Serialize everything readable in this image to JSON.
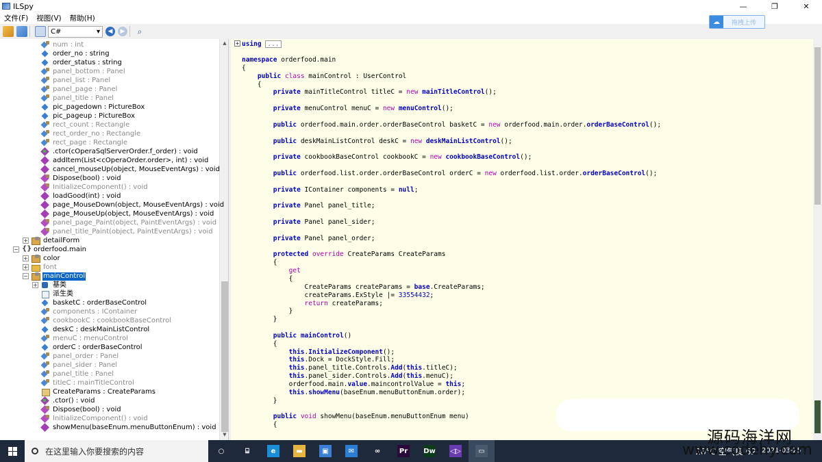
{
  "window": {
    "title": "ILSpy",
    "minimize": "—",
    "maximize": "❐",
    "close": "✕"
  },
  "menu": [
    "文件(F)",
    "视图(V)",
    "帮助(H)"
  ],
  "toolbar": {
    "language": "C#",
    "upload_label": "拖拽上传"
  },
  "tree": [
    {
      "text": "num : int",
      "indent": 60,
      "icon": "field",
      "gray": true
    },
    {
      "text": "order_no : string",
      "indent": 60,
      "icon": "fieldpub",
      "gray": false
    },
    {
      "text": "order_status : string",
      "indent": 60,
      "icon": "fieldpub",
      "gray": false
    },
    {
      "text": "panel_bottom : Panel",
      "indent": 60,
      "icon": "field",
      "gray": true
    },
    {
      "text": "panel_list : Panel",
      "indent": 60,
      "icon": "field",
      "gray": true
    },
    {
      "text": "panel_page : Panel",
      "indent": 60,
      "icon": "field",
      "gray": true
    },
    {
      "text": "panel_title : Panel",
      "indent": 60,
      "icon": "field",
      "gray": true
    },
    {
      "text": "pic_pagedown : PictureBox",
      "indent": 60,
      "icon": "fieldpub",
      "gray": false
    },
    {
      "text": "pic_pageup : PictureBox",
      "indent": 60,
      "icon": "fieldpub",
      "gray": false
    },
    {
      "text": "rect_count : Rectangle",
      "indent": 60,
      "icon": "field",
      "gray": true
    },
    {
      "text": "rect_order_no : Rectangle",
      "indent": 60,
      "icon": "field",
      "gray": true
    },
    {
      "text": "rect_page : Rectangle",
      "indent": 60,
      "icon": "field",
      "gray": true
    },
    {
      "text": ".ctor(cOperaSqlServerOrder.f_order) : void",
      "indent": 60,
      "icon": "ctor",
      "gray": false
    },
    {
      "text": "addItem(List<cOperaOrder.order>, int) : void",
      "indent": 60,
      "icon": "methodpub",
      "gray": false
    },
    {
      "text": "cancel_mouseUp(object, MouseEventArgs) : void",
      "indent": 60,
      "icon": "methodpub",
      "gray": false
    },
    {
      "text": "Dispose(bool) : void",
      "indent": 60,
      "icon": "method",
      "gray": false
    },
    {
      "text": "InitializeComponent() : void",
      "indent": 60,
      "icon": "method",
      "gray": true
    },
    {
      "text": "loadGood(int) : void",
      "indent": 60,
      "icon": "methodpub",
      "gray": false
    },
    {
      "text": "page_MouseDown(object, MouseEventArgs) : void",
      "indent": 60,
      "icon": "methodpub",
      "gray": false
    },
    {
      "text": "page_MouseUp(object, MouseEventArgs) : void",
      "indent": 60,
      "icon": "methodpub",
      "gray": false
    },
    {
      "text": "panel_page_Paint(object, PaintEventArgs) : void",
      "indent": 60,
      "icon": "method",
      "gray": true
    },
    {
      "text": "panel_title_Paint(object, PaintEventArgs) : void",
      "indent": 60,
      "icon": "method",
      "gray": true
    },
    {
      "text": "detailForm",
      "indent": 46,
      "icon": "cls",
      "gray": false,
      "expander": "+"
    },
    {
      "text": "orderfood.main",
      "indent": 32,
      "icon": "ns",
      "gray": false,
      "expander": "−"
    },
    {
      "text": "color",
      "indent": 46,
      "icon": "cls",
      "gray": false,
      "expander": "+"
    },
    {
      "text": "font",
      "indent": 46,
      "icon": "folder",
      "gray": true,
      "expander": "+"
    },
    {
      "text": "mainControl",
      "indent": 46,
      "icon": "cls",
      "gray": false,
      "expander": "−",
      "selected": true
    },
    {
      "text": "基类",
      "indent": 60,
      "icon": "base",
      "gray": false,
      "expander": "+"
    },
    {
      "text": "派生类",
      "indent": 60,
      "icon": "derived",
      "gray": false
    },
    {
      "text": "basketC : orderBaseControl",
      "indent": 60,
      "icon": "fieldpub",
      "gray": false
    },
    {
      "text": "components : IContainer",
      "indent": 60,
      "icon": "field",
      "gray": true
    },
    {
      "text": "cookbookC : cookbookBaseControl",
      "indent": 60,
      "icon": "field",
      "gray": true
    },
    {
      "text": "deskC : deskMainListControl",
      "indent": 60,
      "icon": "fieldpub",
      "gray": false
    },
    {
      "text": "menuC : menuControl",
      "indent": 60,
      "icon": "field",
      "gray": true
    },
    {
      "text": "orderC : orderBaseControl",
      "indent": 60,
      "icon": "fieldpub",
      "gray": false
    },
    {
      "text": "panel_order : Panel",
      "indent": 60,
      "icon": "field",
      "gray": true
    },
    {
      "text": "panel_sider : Panel",
      "indent": 60,
      "icon": "field",
      "gray": true
    },
    {
      "text": "panel_title : Panel",
      "indent": 60,
      "icon": "field",
      "gray": true
    },
    {
      "text": "titleC : mainTitleControl",
      "indent": 60,
      "icon": "field",
      "gray": true
    },
    {
      "text": "CreateParams : CreateParams",
      "indent": 60,
      "icon": "prop",
      "gray": false
    },
    {
      "text": ".ctor() : void",
      "indent": 60,
      "icon": "ctor",
      "gray": false
    },
    {
      "text": "Dispose(bool) : void",
      "indent": 60,
      "icon": "method",
      "gray": false
    },
    {
      "text": "InitializeComponent() : void",
      "indent": 60,
      "icon": "method",
      "gray": true
    },
    {
      "text": "showMenu(baseEnum.menuButtonEnum) : void",
      "indent": 60,
      "icon": "methodpub",
      "gray": false
    }
  ],
  "code": {
    "using_kw": "using",
    "using_fold": "...",
    "lines": [
      [
        {
          "t": "namespace ",
          "c": "kw"
        },
        {
          "t": "orderfood.main"
        }
      ],
      [
        {
          "t": "{"
        }
      ],
      [
        {
          "t": "    "
        },
        {
          "t": "public ",
          "c": "kw"
        },
        {
          "t": "class ",
          "c": "kw2"
        },
        {
          "t": "mainControl : UserControl"
        }
      ],
      [
        {
          "t": "    {"
        }
      ],
      [
        {
          "t": "        "
        },
        {
          "t": "private ",
          "c": "kw"
        },
        {
          "t": "mainTitleControl titleC = "
        },
        {
          "t": "new ",
          "c": "kw2"
        },
        {
          "t": "mainTitleControl",
          "c": "kw"
        },
        {
          "t": "();"
        }
      ],
      [],
      [
        {
          "t": "        "
        },
        {
          "t": "private ",
          "c": "kw"
        },
        {
          "t": "menuControl menuC = "
        },
        {
          "t": "new ",
          "c": "kw2"
        },
        {
          "t": "menuControl",
          "c": "kw"
        },
        {
          "t": "();"
        }
      ],
      [],
      [
        {
          "t": "        "
        },
        {
          "t": "public ",
          "c": "kw"
        },
        {
          "t": "orderfood.main.order.orderBaseControl basketC = "
        },
        {
          "t": "new ",
          "c": "kw2"
        },
        {
          "t": "orderfood.main.order."
        },
        {
          "t": "orderBaseControl",
          "c": "kw"
        },
        {
          "t": "();"
        }
      ],
      [],
      [
        {
          "t": "        "
        },
        {
          "t": "public ",
          "c": "kw"
        },
        {
          "t": "deskMainListControl deskC = "
        },
        {
          "t": "new ",
          "c": "kw2"
        },
        {
          "t": "deskMainListControl",
          "c": "kw"
        },
        {
          "t": "();"
        }
      ],
      [],
      [
        {
          "t": "        "
        },
        {
          "t": "private ",
          "c": "kw"
        },
        {
          "t": "cookbookBaseControl cookbookC = "
        },
        {
          "t": "new ",
          "c": "kw2"
        },
        {
          "t": "cookbookBaseControl",
          "c": "kw"
        },
        {
          "t": "();"
        }
      ],
      [],
      [
        {
          "t": "        "
        },
        {
          "t": "public ",
          "c": "kw"
        },
        {
          "t": "orderfood.list.order.orderBaseControl orderC = "
        },
        {
          "t": "new ",
          "c": "kw2"
        },
        {
          "t": "orderfood.list.order."
        },
        {
          "t": "orderBaseControl",
          "c": "kw"
        },
        {
          "t": "();"
        }
      ],
      [],
      [
        {
          "t": "        "
        },
        {
          "t": "private ",
          "c": "kw"
        },
        {
          "t": "IContainer components = "
        },
        {
          "t": "null",
          "c": "kw"
        },
        {
          "t": ";"
        }
      ],
      [],
      [
        {
          "t": "        "
        },
        {
          "t": "private ",
          "c": "kw"
        },
        {
          "t": "Panel panel_title;"
        }
      ],
      [],
      [
        {
          "t": "        "
        },
        {
          "t": "private ",
          "c": "kw"
        },
        {
          "t": "Panel panel_sider;"
        }
      ],
      [],
      [
        {
          "t": "        "
        },
        {
          "t": "private ",
          "c": "kw"
        },
        {
          "t": "Panel panel_order;"
        }
      ],
      [],
      [
        {
          "t": "        "
        },
        {
          "t": "protected ",
          "c": "kw"
        },
        {
          "t": "override ",
          "c": "kw2"
        },
        {
          "t": "CreateParams CreateParams"
        }
      ],
      [
        {
          "t": "        {"
        }
      ],
      [
        {
          "t": "            "
        },
        {
          "t": "get",
          "c": "kw2"
        }
      ],
      [
        {
          "t": "            {"
        }
      ],
      [
        {
          "t": "                CreateParams createParams = "
        },
        {
          "t": "base",
          "c": "kw"
        },
        {
          "t": ".CreateParams;"
        }
      ],
      [
        {
          "t": "                createParams.ExStyle |= "
        },
        {
          "t": "33554432",
          "c": "num"
        },
        {
          "t": ";"
        }
      ],
      [
        {
          "t": "                "
        },
        {
          "t": "return ",
          "c": "kw2"
        },
        {
          "t": "createParams;"
        }
      ],
      [
        {
          "t": "            }"
        }
      ],
      [
        {
          "t": "        }"
        }
      ],
      [],
      [
        {
          "t": "        "
        },
        {
          "t": "public ",
          "c": "kw"
        },
        {
          "t": "mainControl",
          "c": "kw"
        },
        {
          "t": "()"
        }
      ],
      [
        {
          "t": "        {"
        }
      ],
      [
        {
          "t": "            "
        },
        {
          "t": "this",
          "c": "kw"
        },
        {
          "t": "."
        },
        {
          "t": "InitializeComponent",
          "c": "kw"
        },
        {
          "t": "();"
        }
      ],
      [
        {
          "t": "            "
        },
        {
          "t": "this",
          "c": "kw"
        },
        {
          "t": ".Dock = DockStyle.Fill;"
        }
      ],
      [
        {
          "t": "            "
        },
        {
          "t": "this",
          "c": "kw"
        },
        {
          "t": ".panel_title.Controls."
        },
        {
          "t": "Add",
          "c": "kw"
        },
        {
          "t": "("
        },
        {
          "t": "this",
          "c": "kw"
        },
        {
          "t": ".titleC);"
        }
      ],
      [
        {
          "t": "            "
        },
        {
          "t": "this",
          "c": "kw"
        },
        {
          "t": ".panel_sider.Controls."
        },
        {
          "t": "Add",
          "c": "kw"
        },
        {
          "t": "("
        },
        {
          "t": "this",
          "c": "kw"
        },
        {
          "t": ".menuC);"
        }
      ],
      [
        {
          "t": "            orderfood.main."
        },
        {
          "t": "value",
          "c": "kw"
        },
        {
          "t": ".maincontrolValue = "
        },
        {
          "t": "this",
          "c": "kw"
        },
        {
          "t": ";"
        }
      ],
      [
        {
          "t": "            "
        },
        {
          "t": "this",
          "c": "kw"
        },
        {
          "t": "."
        },
        {
          "t": "showMenu",
          "c": "kw"
        },
        {
          "t": "(baseEnum.menuButtonEnum.order);"
        }
      ],
      [
        {
          "t": "        }"
        }
      ],
      [],
      [
        {
          "t": "        "
        },
        {
          "t": "public ",
          "c": "kw"
        },
        {
          "t": "void ",
          "c": "kw2"
        },
        {
          "t": "showMenu(baseEnum.menuButtonEnum menu)"
        }
      ],
      [
        {
          "t": "        {"
        }
      ]
    ]
  },
  "taskbar": {
    "search_placeholder": "在这里输入你要搜索的内容",
    "weather": "28°C 空气良 62",
    "time": "",
    "date": "2021-03-25",
    "apps": [
      {
        "name": "task-view",
        "label": "○",
        "color": "transparent"
      },
      {
        "name": "widgets",
        "label": "⌸",
        "color": "transparent"
      },
      {
        "name": "edge",
        "label": "e",
        "color": "#1a8fd8"
      },
      {
        "name": "file-explorer",
        "label": "▬",
        "color": "#e8b440"
      },
      {
        "name": "store",
        "label": "▣",
        "color": "#3a7fd4"
      },
      {
        "name": "mail",
        "label": "✉",
        "color": "#2a7fd4"
      },
      {
        "name": "link",
        "label": "∞",
        "color": "transparent"
      },
      {
        "name": "premiere",
        "label": "Pr",
        "color": "#2a0a3a"
      },
      {
        "name": "dreamweaver",
        "label": "Dw",
        "color": "#0d3a1a"
      },
      {
        "name": "visual-studio",
        "label": "◁▷",
        "color": "#6a3ab0"
      },
      {
        "name": "ilspy",
        "label": "▭",
        "color": "#4a5a6e"
      }
    ]
  },
  "watermark": {
    "line1": "源码海洋网",
    "line2": "www.codehy.com"
  }
}
